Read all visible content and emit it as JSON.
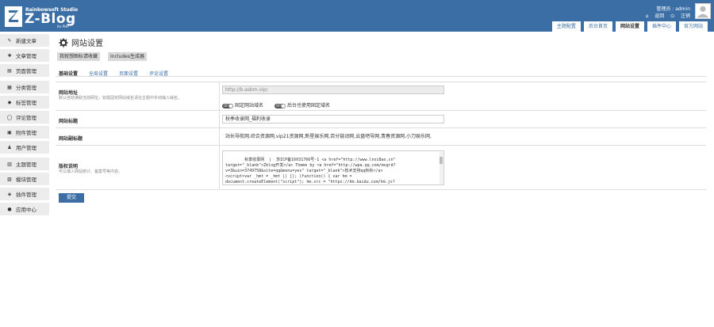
{
  "header": {
    "brand_small": "Rainbowsoft Studio",
    "brand_big": "Z-Blog",
    "brand_tiny": "for PHP",
    "user_label": "管理员 : admin",
    "return_label": "返回",
    "logout_label": "注销"
  },
  "topnav": [
    {
      "label": "主题配置",
      "active": false
    },
    {
      "label": "后台首页",
      "active": false
    },
    {
      "label": "网站设置",
      "active": true
    },
    {
      "label": "插件中心",
      "active": false
    },
    {
      "label": "官方网站",
      "active": false
    }
  ],
  "sidebar": [
    {
      "label": "新建文章",
      "icon": "pencil-icon"
    },
    {
      "label": "文章管理",
      "icon": "pin-icon"
    },
    {
      "label": "页面管理",
      "icon": "page-icon"
    },
    {
      "label": "分类管理",
      "icon": "folder-icon"
    },
    {
      "label": "标签管理",
      "icon": "tag-icon"
    },
    {
      "label": "评论管理",
      "icon": "comment-icon"
    },
    {
      "label": "附件管理",
      "icon": "attachment-icon"
    },
    {
      "label": "用户管理",
      "icon": "user-icon"
    },
    {
      "label": "主题管理",
      "icon": "theme-icon"
    },
    {
      "label": "模块管理",
      "icon": "module-icon"
    },
    {
      "label": "插件管理",
      "icon": "plugin-icon"
    },
    {
      "label": "应用中心",
      "icon": "app-icon"
    }
  ],
  "page": {
    "title": "网站设置",
    "sub_buttons": [
      "我就想图标请收藏",
      "Includes生成器"
    ],
    "tabs": [
      {
        "label": "基础设置",
        "active": true
      },
      {
        "label": "全局设置",
        "active": false
      },
      {
        "label": "页面设置",
        "active": false
      },
      {
        "label": "评论设置",
        "active": false
      }
    ],
    "rows": {
      "site_url": {
        "label": "网站地址",
        "desc": "默认自动读取当前网址，如需固定网站域名请在主题中手动输入域名。",
        "value": "http://b.asbm.vip/",
        "toggle1_label": "固定网站域名",
        "toggle2_label": "后台也使用固定域名",
        "toggle_text": "OFF"
      },
      "site_name": {
        "label": "网站标题",
        "value": "秋季收录网_福利收录"
      },
      "site_subtitle": {
        "label": "网站副标题",
        "value": "站长导航网,综合资源网,vip21资源网,新星娱乐网,百分链动网,云盘吧导网,青春资源网,小刀娱乐网,"
      },
      "copyright": {
        "label": "版权说明",
        "desc": "可以填入网站统计、备案号等内容。",
        "value": "秋季收录网  |  苏ICP备16031766号-1 <a href=\"http://www.lnoi8ao.cn\"\ntarget=\"_blank\">Zblog开发</a> Theme by <a href=\"http://wpa.qq.com/msgrd?\nv=3&uin=3749758&site=qq&menu=yes\" target=\"_blank\">技术支持qq秋秋</a>\n<script>var _hmt = _hmt || []; (function() { var hm =\ndocument.createElement(\"script\"); hm.src = \"https://hm.baidu.com/hm.js?\n5fbcad72824a8ce9621738816c81e0\"; var s = document.getElementsByTagName(\"script\")"
      }
    },
    "submit_label": "提交"
  }
}
